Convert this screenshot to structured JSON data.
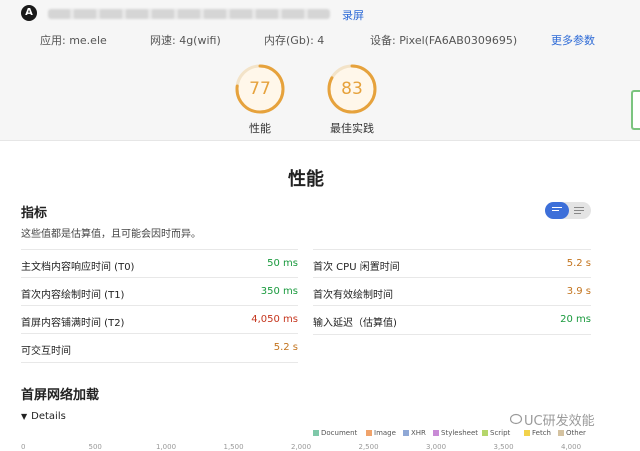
{
  "header": {
    "logo_glyph": "A",
    "record_label": "录屏",
    "meta": [
      {
        "label": "应用: me.ele"
      },
      {
        "label": "网速: 4g(wifi)"
      },
      {
        "label": "内存(Gb): 4"
      },
      {
        "label": "设备: Pixel(FA6AB0309695)"
      }
    ],
    "more_label": "更多参数",
    "scores": [
      {
        "value": "77",
        "label": "性能",
        "fraction": 0.77
      },
      {
        "value": "83",
        "label": "最佳实践",
        "fraction": 0.83
      }
    ]
  },
  "main": {
    "title": "性能",
    "metrics_heading": "指标",
    "metrics_description": "这些值都是估算值，且可能会因时而异。",
    "metrics_left": [
      {
        "label": "主文档内容响应时间 (T0)",
        "value": "50 ms",
        "status": "green"
      },
      {
        "label": "首次内容绘制时间 (T1)",
        "value": "350 ms",
        "status": "green"
      },
      {
        "label": "首屏内容铺满时间 (T2)",
        "value": "4,050 ms",
        "status": "red"
      },
      {
        "label": "可交互时间",
        "value": "5.2 s",
        "status": "orange"
      }
    ],
    "metrics_right": [
      {
        "label": "首次 CPU 闲置时间",
        "value": "5.2 s",
        "status": "orange"
      },
      {
        "label": "首次有效绘制时间",
        "value": "3.9 s",
        "status": "orange"
      },
      {
        "label": "输入延迟（估算值)",
        "value": "20 ms",
        "status": "green"
      }
    ],
    "network_heading": "首屏网络加载",
    "details_label": "Details",
    "timeline_ticks": [
      "0",
      "500",
      "1,000",
      "1,500",
      "2,000",
      "2,500",
      "3,000",
      "3,500",
      "4,000"
    ],
    "legend": [
      {
        "name": "Document",
        "color": "#7fc8a9"
      },
      {
        "name": "Image",
        "color": "#f0a36b"
      },
      {
        "name": "XHR",
        "color": "#8fa8d6"
      },
      {
        "name": "Stylesheet",
        "color": "#c98bd6"
      },
      {
        "name": "Script",
        "color": "#b5d66b"
      },
      {
        "name": "Fetch",
        "color": "#f2d24b"
      },
      {
        "name": "Other",
        "color": "#d4c2a0"
      }
    ]
  },
  "watermark": "UC研发效能",
  "colors": {
    "score": "#e6a23c",
    "link": "#2d6ad6",
    "toggle_on": "#3d6fd9"
  }
}
